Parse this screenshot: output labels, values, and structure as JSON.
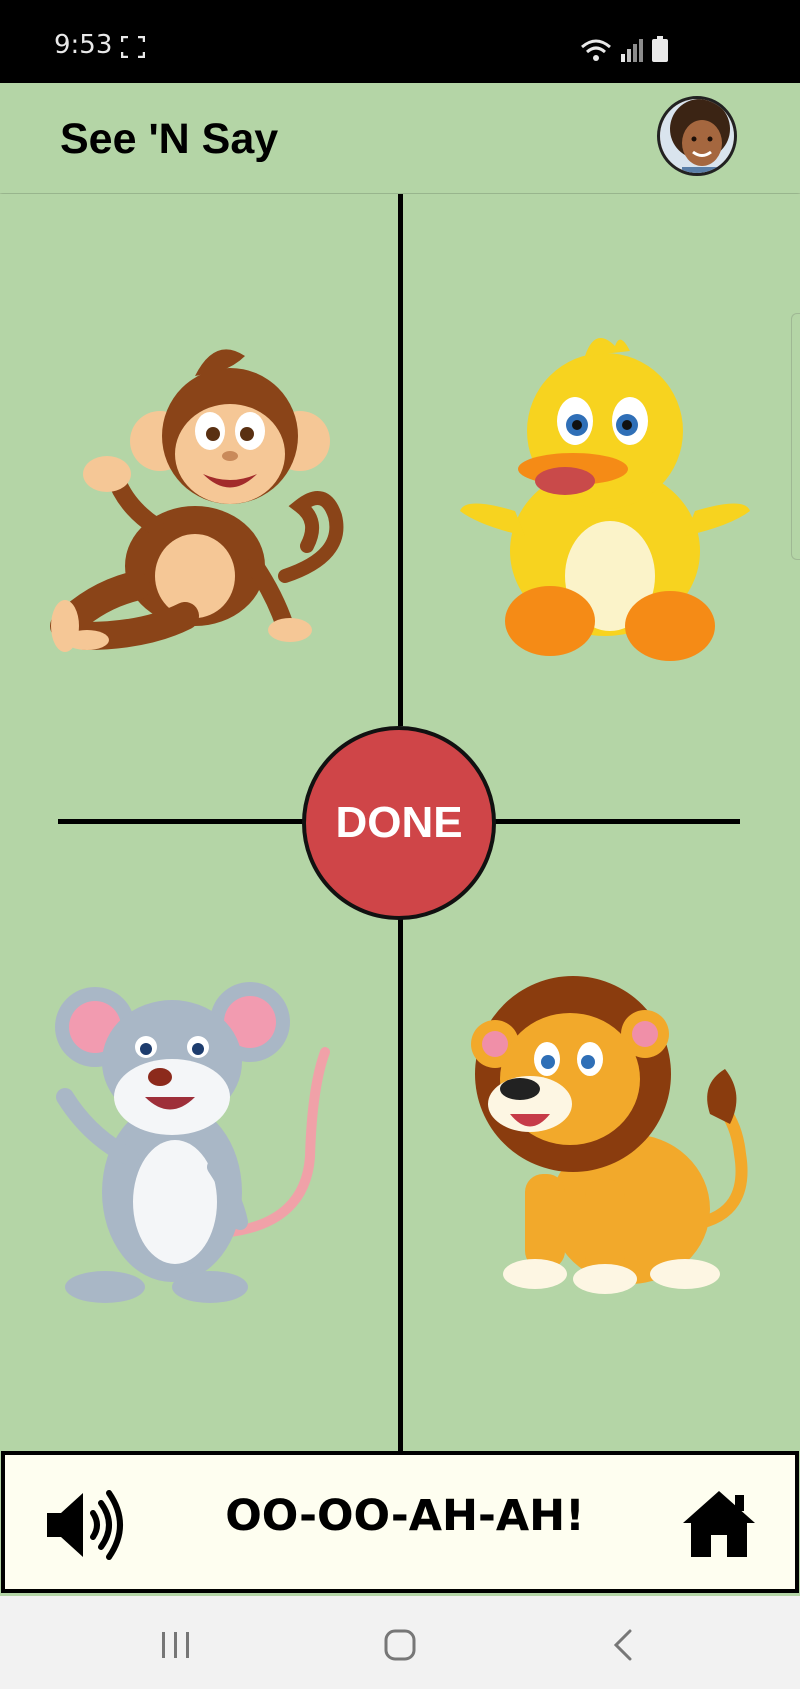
{
  "status_bar": {
    "time": "9:53",
    "icons": [
      "screenshot-frame-icon",
      "wifi-icon",
      "signal-icon",
      "battery-icon"
    ]
  },
  "app_bar": {
    "title": "See 'N Say",
    "avatar_icon": "child-avatar-icon"
  },
  "play_area": {
    "animals": [
      {
        "name": "monkey",
        "icon": "monkey-icon"
      },
      {
        "name": "duck",
        "icon": "duck-icon"
      },
      {
        "name": "mouse",
        "icon": "mouse-icon"
      },
      {
        "name": "lion",
        "icon": "lion-icon"
      }
    ],
    "done_label": "DONE",
    "done_color": "#cf4548"
  },
  "bottom_panel": {
    "sound_text": "OO-OO-AH-AH!",
    "sound_icon": "speaker-icon",
    "home_icon": "home-icon"
  },
  "nav_bar": {
    "buttons": [
      "recent-apps-icon",
      "home-circle-icon",
      "back-icon"
    ]
  },
  "colors": {
    "background": "#b4d5a6",
    "panel": "#fefef0"
  }
}
